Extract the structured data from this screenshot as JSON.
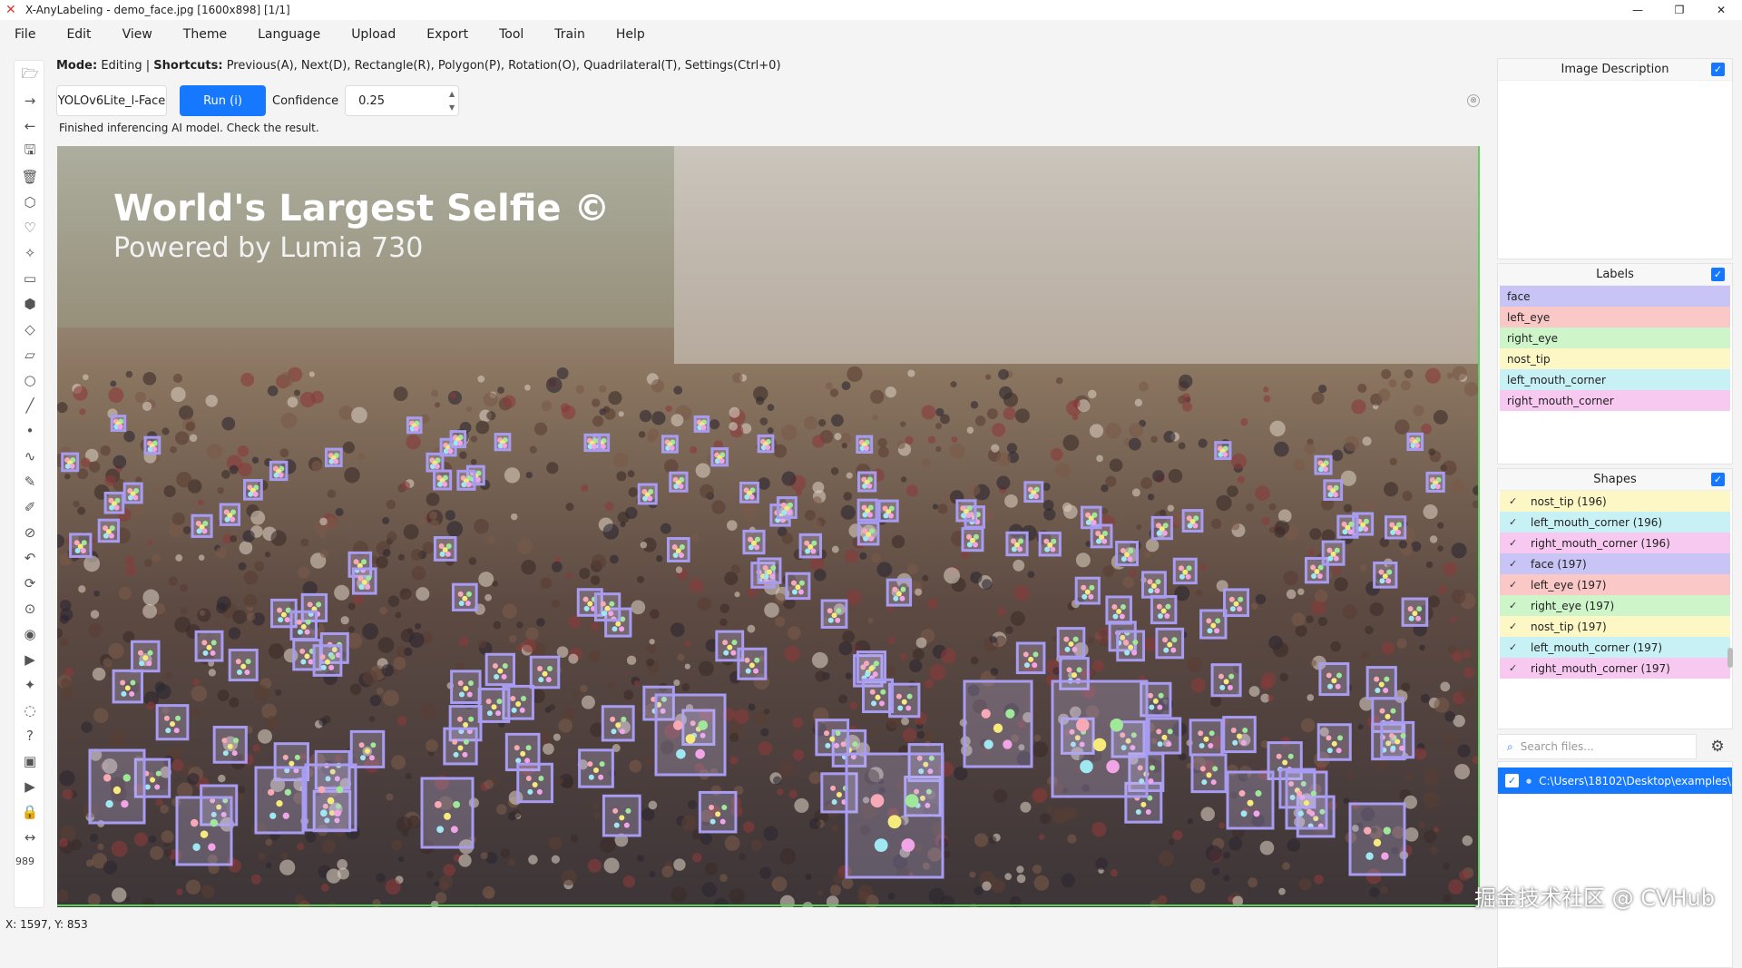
{
  "window": {
    "title": "X-AnyLabeling - demo_face.jpg [1600x898] [1/1]",
    "min": "—",
    "max": "❐",
    "close": "✕"
  },
  "menu": [
    "File",
    "Edit",
    "View",
    "Theme",
    "Language",
    "Upload",
    "Export",
    "Tool",
    "Train",
    "Help"
  ],
  "toolbar_icons": [
    "open-folder-icon",
    "next-image-icon",
    "prev-image-icon",
    "save-icon",
    "delete-icon",
    "polygon-icon",
    "heart-icon",
    "ai-magic-icon",
    "rectangle-icon",
    "cube-icon",
    "rotation-icon",
    "quadrilateral-icon",
    "circle-icon",
    "line-icon",
    "point-icon",
    "linestrip-icon",
    "brush-icon",
    "edit-icon",
    "cancel-icon",
    "undo-icon",
    "loop-icon",
    "auto-label-icon",
    "eye-icon",
    "play-icon",
    "star-icon",
    "chat-icon",
    "help-icon",
    "image-icon",
    "video-icon",
    "lock-icon",
    "fit-width-icon"
  ],
  "zoom": "989",
  "mode": {
    "prefix": "Mode:",
    "mode_value": " Editing | ",
    "shortcuts_label": "Shortcuts:",
    "shortcuts_text": " Previous(A), Next(D), Rectangle(R), Polygon(P), Rotation(O), Quadrilateral(T), Settings(Ctrl+0)"
  },
  "ai": {
    "model": "YOLOv6Lite_l-Face",
    "run": "Run (i)",
    "confidence_label": "Confidence",
    "confidence": "0.25",
    "clear": "⊗"
  },
  "status": "Finished inferencing AI model. Check the result.",
  "canvas": {
    "headline": "World's Largest Selfie ©",
    "subline": "Powered by Lumia 730"
  },
  "panels": {
    "description": {
      "title": "Image Description"
    },
    "labels": {
      "title": "Labels",
      "items": [
        {
          "name": "face",
          "color": "#c9c4f6"
        },
        {
          "name": "left_eye",
          "color": "#fbc8c8"
        },
        {
          "name": "right_eye",
          "color": "#cdf5c9"
        },
        {
          "name": "nost_tip",
          "color": "#fdf7c6"
        },
        {
          "name": "left_mouth_corner",
          "color": "#c8f1f6"
        },
        {
          "name": "right_mouth_corner",
          "color": "#f7c8f0"
        }
      ]
    },
    "shapes": {
      "title": "Shapes",
      "items": [
        {
          "name": "nost_tip (196)",
          "color": "#fdf7c6"
        },
        {
          "name": "left_mouth_corner (196)",
          "color": "#c8f1f6"
        },
        {
          "name": "right_mouth_corner (196)",
          "color": "#f7c8f0"
        },
        {
          "name": "face (197)",
          "color": "#c9c4f6"
        },
        {
          "name": "left_eye (197)",
          "color": "#fbc8c8"
        },
        {
          "name": "right_eye (197)",
          "color": "#cdf5c9"
        },
        {
          "name": "nost_tip (197)",
          "color": "#fdf7c6"
        },
        {
          "name": "left_mouth_corner (197)",
          "color": "#c8f1f6"
        },
        {
          "name": "right_mouth_corner (197)",
          "color": "#f7c8f0"
        }
      ]
    },
    "files": {
      "search_placeholder": "Search files...",
      "items": [
        "C:\\Users\\18102\\Desktop\\examples\\"
      ]
    }
  },
  "coords": "X: 1597, Y: 853",
  "watermark": "掘金技术社区 @ CVHub"
}
